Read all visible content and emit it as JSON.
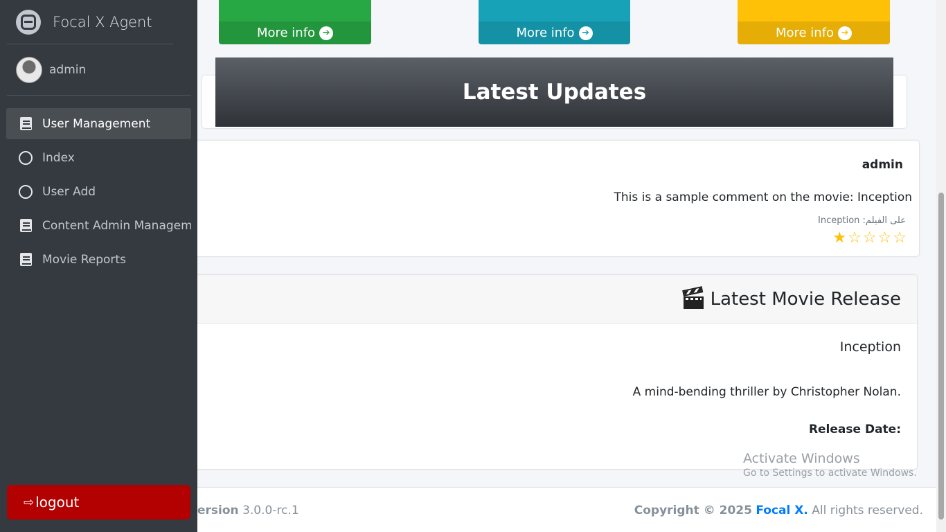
{
  "sidebar": {
    "brand": "Focal X Agent",
    "user": "admin",
    "items": [
      {
        "label": "User Management",
        "icon": "book-icon",
        "active": true
      },
      {
        "label": "Index",
        "icon": "circle-icon"
      },
      {
        "label": "User Add",
        "icon": "circle-icon"
      },
      {
        "label": "Content Admin Manageme",
        "icon": "book-icon"
      },
      {
        "label": "Movie Reports",
        "icon": "book-icon"
      }
    ],
    "logout": "logout"
  },
  "info_boxes": [
    {
      "label": "More info",
      "color": "#28a745"
    },
    {
      "label": "More info",
      "color": "#17a2b8"
    },
    {
      "label": "More info",
      "color": "#ffc107"
    }
  ],
  "updates": {
    "title": "Latest Updates"
  },
  "comment": {
    "user": "admin",
    "text": "This is a sample comment on the movie: Inception",
    "movie_line": "على الفيلم: Inception",
    "rating": 1,
    "max_rating": 5
  },
  "movie": {
    "header": "Latest Movie Release",
    "title": "Inception",
    "description": "A mind-bending thriller by Christopher Nolan.",
    "release_label": "Release Date:"
  },
  "watermark": {
    "title": "Activate Windows",
    "subtitle": "Go to Settings to activate Windows."
  },
  "footer": {
    "version_label": "ersion",
    "version_value": "3.0.0-rc.1",
    "copyright": "Copyright © 2025",
    "brand": "Focal X.",
    "rights": "All rights reserved."
  }
}
